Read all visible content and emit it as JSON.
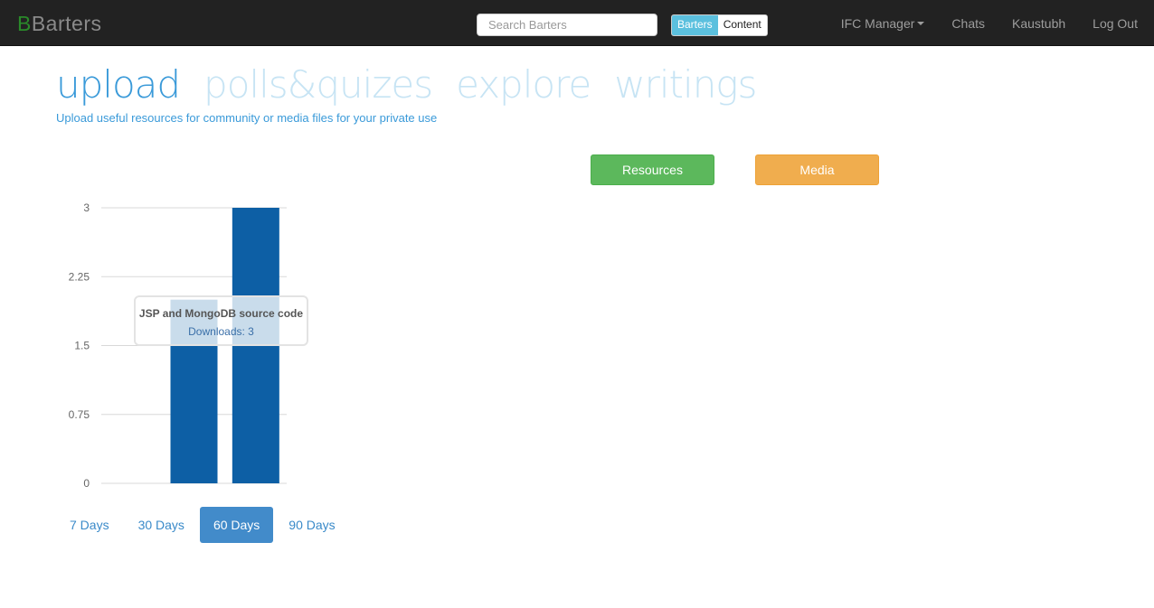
{
  "navbar": {
    "brand_initial": "B",
    "brand_rest": "Barters",
    "search_placeholder": "Search Barters",
    "toggle": {
      "active": "Barters",
      "inactive": "Content"
    },
    "items": [
      {
        "label": "IFC Manager",
        "has_caret": true
      },
      {
        "label": "Chats"
      },
      {
        "label": "Kaustubh"
      },
      {
        "label": "Log Out"
      }
    ]
  },
  "tabs": [
    {
      "label": "upload",
      "active": true
    },
    {
      "label": "polls&quizes",
      "active": false
    },
    {
      "label": "explore",
      "active": false
    },
    {
      "label": "writings",
      "active": false
    }
  ],
  "subtitle": "Upload useful resources for community or media files for your private use",
  "actions": {
    "resources": "Resources",
    "media": "Media"
  },
  "colors": {
    "bar": "#0d5fa5",
    "accent": "#3a9ad9",
    "success": "#5cb85c",
    "warning": "#f0ad4e"
  },
  "chart_data": {
    "type": "bar",
    "title": "",
    "xlabel": "",
    "ylabel": "",
    "ylim": [
      0,
      3
    ],
    "yticks": [
      "0",
      "0.75",
      "1.5",
      "2.25",
      "3"
    ],
    "categories": [
      "",
      "",
      ""
    ],
    "values": [
      0,
      2,
      3
    ],
    "grid": true,
    "tooltip": {
      "title": "JSP and MongoDB source code",
      "value": "Downloads: 3"
    }
  },
  "ranges": [
    {
      "label": "7 Days",
      "active": false
    },
    {
      "label": "30 Days",
      "active": false
    },
    {
      "label": "60 Days",
      "active": true
    },
    {
      "label": "90 Days",
      "active": false
    }
  ]
}
